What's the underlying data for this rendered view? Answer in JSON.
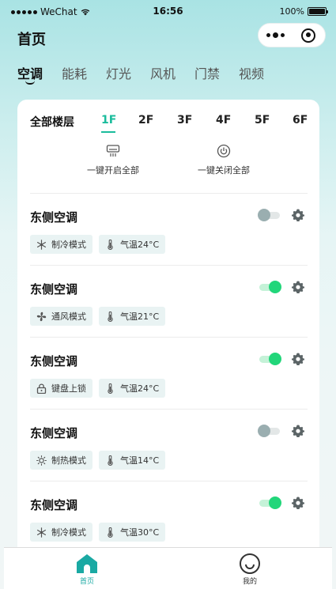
{
  "status_bar": {
    "carrier": "WeChat",
    "time": "16:56",
    "battery": "100%"
  },
  "header": {
    "title": "首页"
  },
  "category_tabs": [
    {
      "label": "空调",
      "active": true
    },
    {
      "label": "能耗",
      "active": false
    },
    {
      "label": "灯光",
      "active": false
    },
    {
      "label": "风机",
      "active": false
    },
    {
      "label": "门禁",
      "active": false
    },
    {
      "label": "视频",
      "active": false
    }
  ],
  "floors": {
    "all_label": "全部楼层",
    "items": [
      "1F",
      "2F",
      "3F",
      "4F",
      "5F",
      "6F"
    ],
    "active": "1F"
  },
  "quick_actions": {
    "open_all": "一键开启全部",
    "close_all": "一键关闭全部"
  },
  "devices": [
    {
      "name": "东侧空调",
      "on": false,
      "mode_icon": "snowflake-icon",
      "mode": "制冷模式",
      "temp": "气温24°C"
    },
    {
      "name": "东侧空调",
      "on": true,
      "mode_icon": "fan-icon",
      "mode": "通风模式",
      "temp": "气温21°C"
    },
    {
      "name": "东侧空调",
      "on": true,
      "mode_icon": "lock-icon",
      "mode": "键盘上锁",
      "temp": "气温24°C"
    },
    {
      "name": "东侧空调",
      "on": false,
      "mode_icon": "sun-icon",
      "mode": "制热模式",
      "temp": "气温14°C"
    },
    {
      "name": "东侧空调",
      "on": true,
      "mode_icon": "snowflake-icon",
      "mode": "制冷模式",
      "temp": "气温30°C"
    }
  ],
  "tabbar": {
    "home": "首页",
    "mine": "我的"
  },
  "colors": {
    "accent": "#1abc9c",
    "toggle_on": "#22d67a",
    "toggle_off": "#9aaeb0",
    "tag_bg": "#e9f3f3"
  }
}
